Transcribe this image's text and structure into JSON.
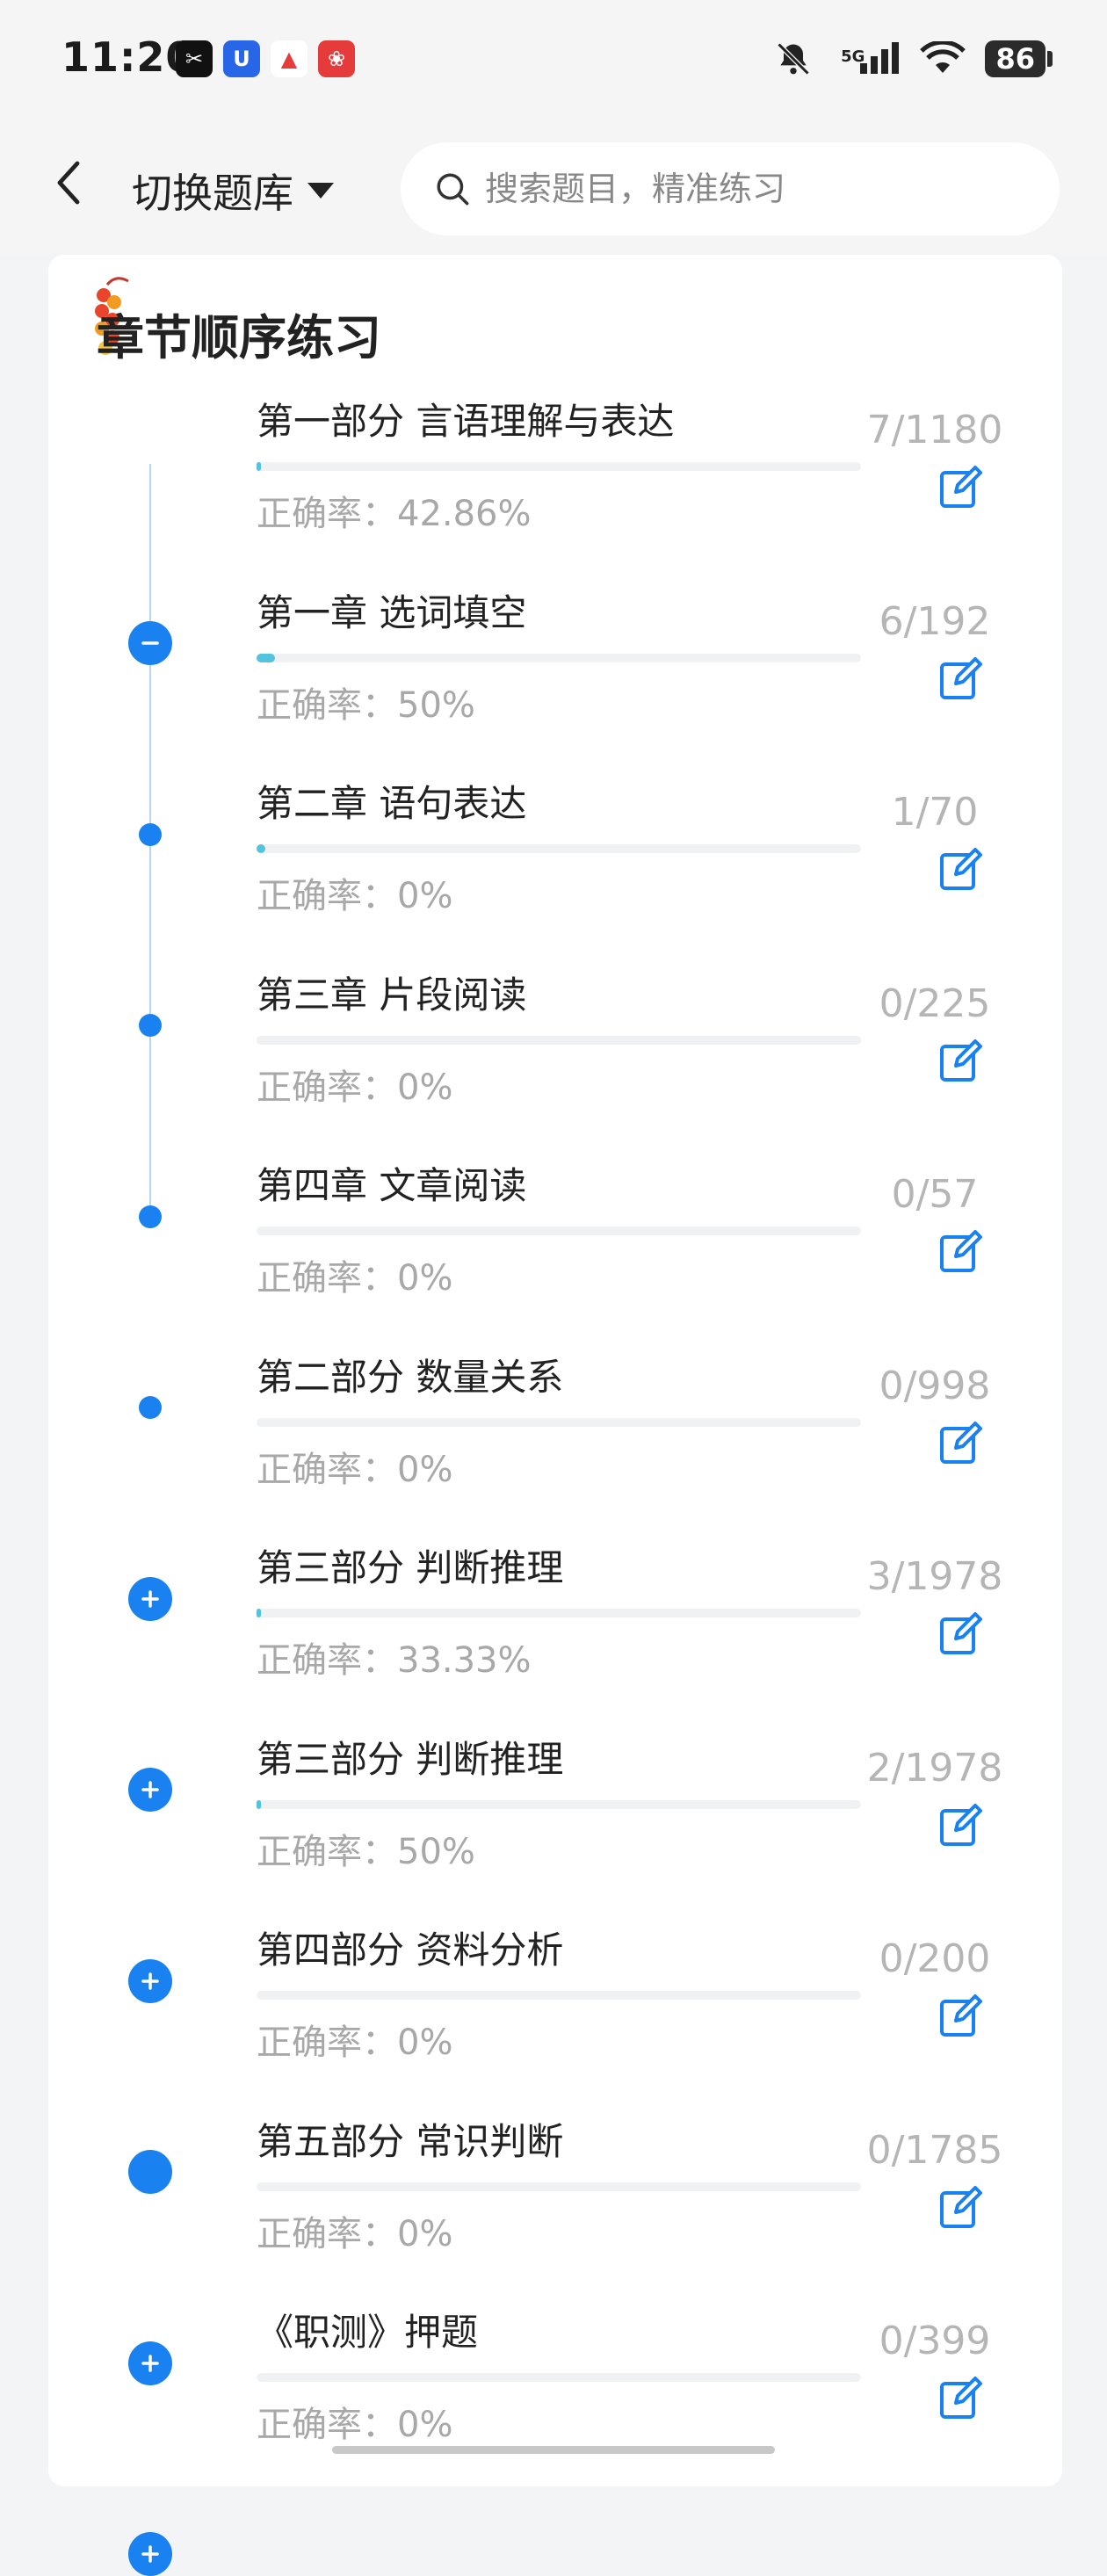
{
  "status_bar": {
    "time": "11:20",
    "network": "5G",
    "battery": "86",
    "icons": [
      "capcut-icon",
      "app-u-icon",
      "app-triangle-icon",
      "app-red-icon",
      "mute-bell-icon",
      "signal-icon",
      "wifi-icon"
    ]
  },
  "nav": {
    "back_icon": "back-arrow-icon",
    "switch_label": "切换题库",
    "search_placeholder": "搜索题目，精准练习"
  },
  "section": {
    "title": "章节顺序练习",
    "accuracy_prefix": "正确率："
  },
  "rows": [
    {
      "title": "第一部分 言语理解与表达",
      "accuracy": "正确率：42.86%",
      "count": "7/1180",
      "progress": 0.006,
      "marker": "minus"
    },
    {
      "title": "第一章 选词填空",
      "accuracy": "正确率：50%",
      "count": "6/192",
      "progress": 0.031,
      "marker": "dot"
    },
    {
      "title": "第二章 语句表达",
      "accuracy": "正确率：0%",
      "count": "1/70",
      "progress": 0.014,
      "marker": "dot"
    },
    {
      "title": "第三章 片段阅读",
      "accuracy": "正确率：0%",
      "count": "0/225",
      "progress": 0,
      "marker": "dot"
    },
    {
      "title": "第四章 文章阅读",
      "accuracy": "正确率：0%",
      "count": "0/57",
      "progress": 0,
      "marker": "dot"
    },
    {
      "title": "第二部分 数量关系",
      "accuracy": "正确率：0%",
      "count": "0/998",
      "progress": 0,
      "marker": "plus"
    },
    {
      "title": "第三部分 判断推理",
      "accuracy": "正确率：33.33%",
      "count": "3/1978",
      "progress": 0.0015,
      "marker": "plus"
    },
    {
      "title": "第三部分 判断推理",
      "accuracy": "正确率：50%",
      "count": "2/1978",
      "progress": 0.001,
      "marker": "plus"
    },
    {
      "title": "第四部分 资料分析",
      "accuracy": "正确率：0%",
      "count": "0/200",
      "progress": 0,
      "marker": "solid"
    },
    {
      "title": "第五部分 常识判断",
      "accuracy": "正确率：0%",
      "count": "0/1785",
      "progress": 0,
      "marker": "plus"
    },
    {
      "title": "《职测》押题",
      "accuracy": "正确率：0%",
      "count": "0/399",
      "progress": 0,
      "marker": "plus"
    }
  ],
  "colors": {
    "accent": "#1a82f0",
    "progress": "#54c3e0",
    "muted": "#a8a8a8"
  }
}
